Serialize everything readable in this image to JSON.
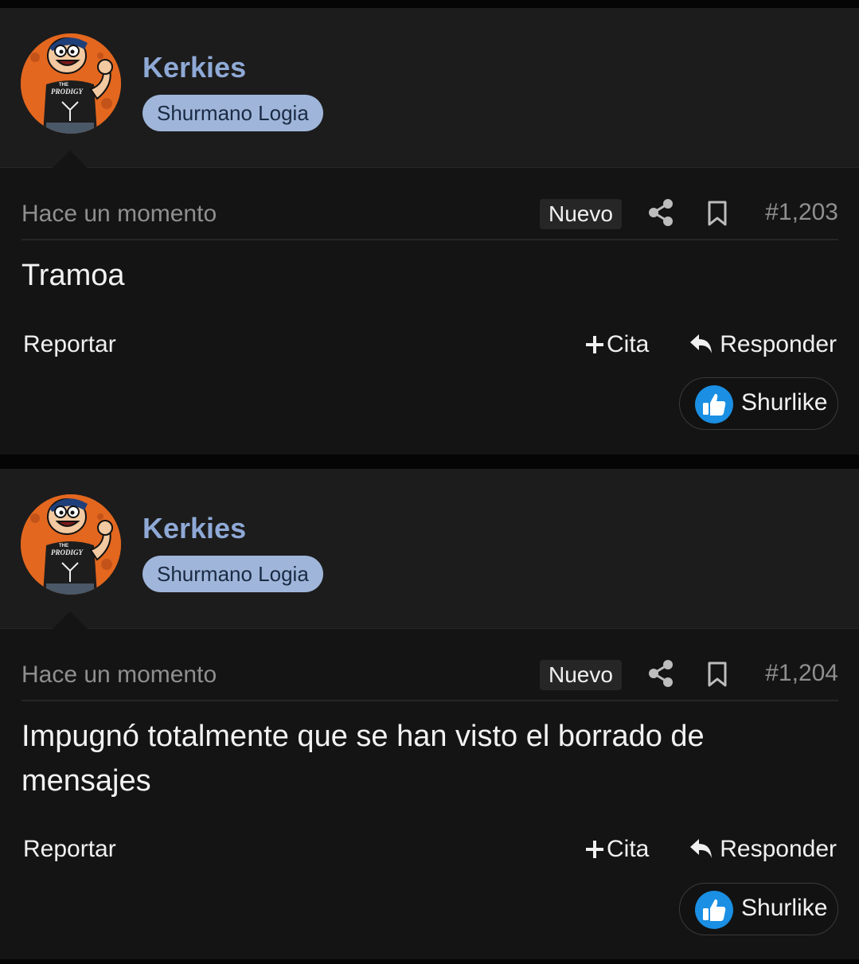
{
  "posts": [
    {
      "username": "Kerkies",
      "rank": "Shurmano Logia",
      "avatar_shirt_text": [
        "THE",
        "PRODIGY"
      ],
      "time": "Hace un momento",
      "badge": "Nuevo",
      "number": "#1,203",
      "body": "Tramoa",
      "report_label": "Reportar",
      "quote_label": "Cita",
      "reply_label": "Responder",
      "like_label": "Shurlike"
    },
    {
      "username": "Kerkies",
      "rank": "Shurmano Logia",
      "avatar_shirt_text": [
        "THE",
        "PRODIGY"
      ],
      "time": "Hace un momento",
      "badge": "Nuevo",
      "number": "#1,204",
      "body": "Impugnó totalmente que se han visto el borrado de mensajes",
      "report_label": "Reportar",
      "quote_label": "Cita",
      "reply_label": "Responder",
      "like_label": "Shurlike"
    }
  ],
  "icons": {
    "share": "share-icon",
    "bookmark": "bookmark-icon",
    "quote": "plus-icon",
    "reply": "reply-arrow-icon",
    "like": "thumbs-up-icon"
  },
  "colors": {
    "background": "#050505",
    "post": "#141414",
    "header": "#1c1c1c",
    "username": "#8fa9d6",
    "rank_badge": "#9fb6da",
    "like_blue": "#1a8fe3",
    "avatar_orange": "#e3671f"
  }
}
